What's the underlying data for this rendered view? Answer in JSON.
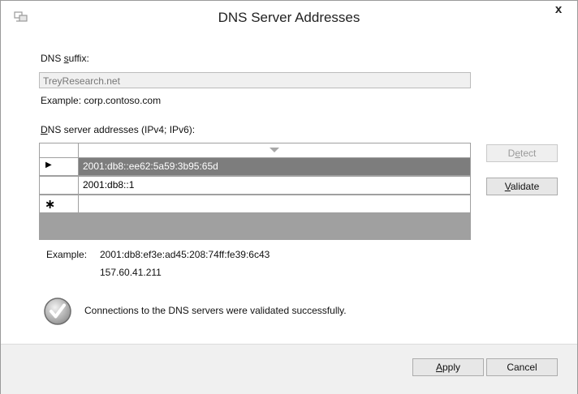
{
  "window": {
    "title": "DNS Server Addresses",
    "close_glyph": "x"
  },
  "dns_suffix": {
    "label_pre": "DNS ",
    "label_accel": "s",
    "label_post": "uffix:",
    "value": "TreyResearch.net",
    "example": "Example: corp.contoso.com"
  },
  "servers": {
    "label_accel": "D",
    "label_post": "NS server addresses (IPv4; IPv6):",
    "rows": [
      {
        "marker": "▶",
        "value": "2001:db8::ee62:5a59:3b95:65d",
        "selected": true
      },
      {
        "marker": "",
        "value": "2001:db8::1",
        "selected": false
      },
      {
        "marker": "∗",
        "value": "",
        "selected": false
      }
    ]
  },
  "buttons": {
    "detect_pre": "D",
    "detect_accel": "e",
    "detect_post": "tect",
    "validate_accel": "V",
    "validate_post": "alidate",
    "apply_accel": "A",
    "apply_post": "pply",
    "cancel": "Cancel"
  },
  "example": {
    "label": "Example:",
    "line1": "2001:db8:ef3e:ad45:208:74ff:fe39:6c43",
    "line2": "157.60.41.211"
  },
  "status": {
    "message": "Connections to the DNS servers were validated successfully.",
    "icon": "check-icon"
  },
  "colors": {
    "selection": "#7d7d7d",
    "grid_border": "#a0a0a0",
    "footer": "#f0f0f0"
  }
}
